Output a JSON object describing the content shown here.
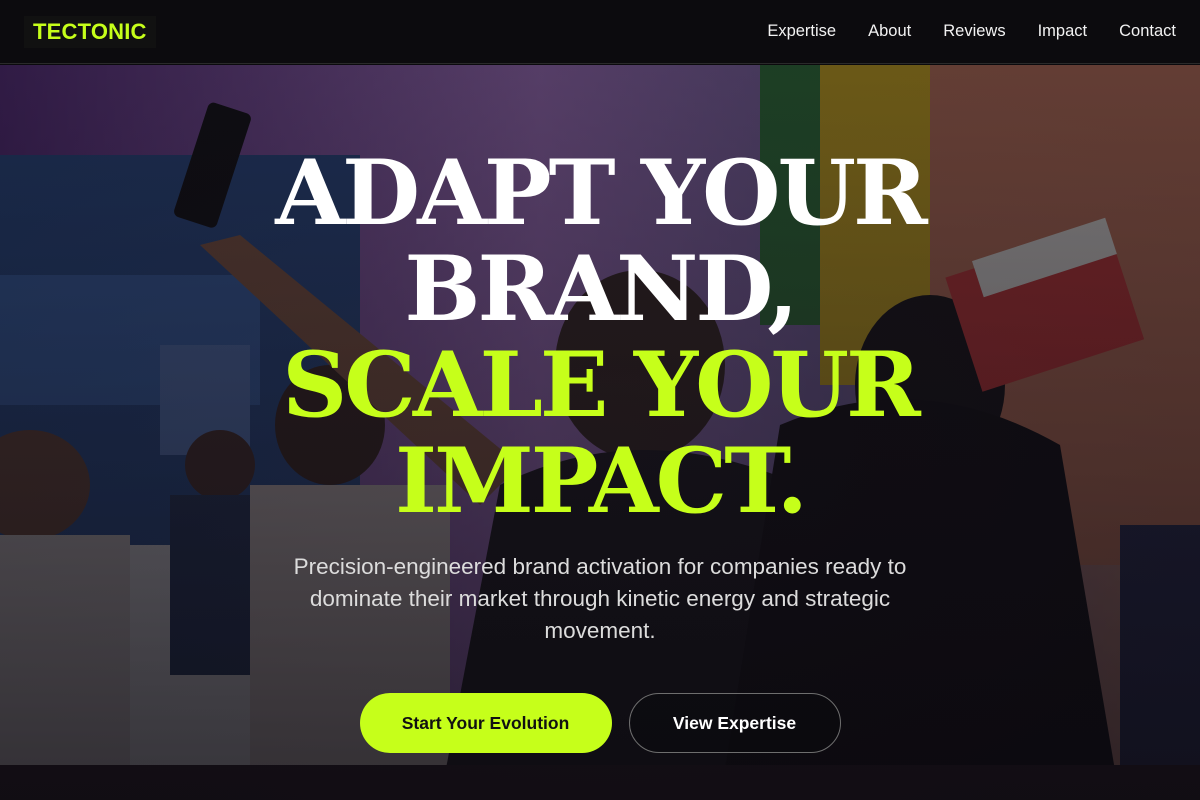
{
  "brand": {
    "logo_text": "TECTONIC",
    "accent_color": "#c6ff1a"
  },
  "nav": {
    "links": [
      {
        "label": "Expertise"
      },
      {
        "label": "About"
      },
      {
        "label": "Reviews"
      },
      {
        "label": "Impact"
      },
      {
        "label": "Contact"
      }
    ]
  },
  "hero": {
    "headline_lines": [
      "ADAPT YOUR",
      "BRAND,",
      "SCALE YOUR",
      "IMPACT."
    ],
    "subtitle": "Precision-engineered brand activation for companies ready to dominate their market through kinetic energy and strategic movement.",
    "primary_cta": "Start Your Evolution",
    "secondary_cta": "View Expertise",
    "background_image": "event crowd photo (person taking selfie at expo booth)"
  }
}
